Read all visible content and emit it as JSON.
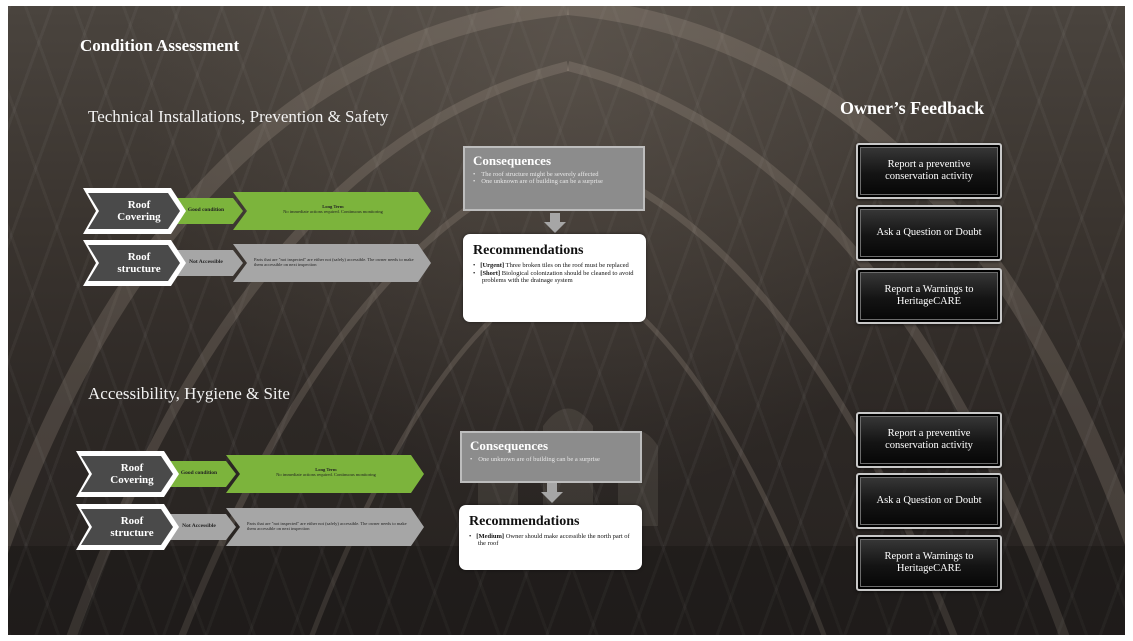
{
  "page": {
    "title": "Condition Assessment",
    "owner_feedback_title": "Owner’s Feedback"
  },
  "sections": [
    {
      "title": "Technical Installations, Prevention & Safety",
      "rows": [
        {
          "label_line1": "Roof",
          "label_line2": "Covering",
          "condition": "Good condition",
          "term_title": "Long Term",
          "term_text": "No immediate actions required. Continuous monitoring"
        },
        {
          "label_line1": "Roof",
          "label_line2": "structure",
          "condition": "Not Accessible",
          "term_title": "",
          "term_text": "Parts that are \"not inspected\" are either not (safely) accessible. The owner needs to make them accessible on next inspection"
        }
      ],
      "consequences": {
        "title": "Consequences",
        "items": [
          "The roof structure might be severely affected",
          "One unknown are of building can be a surprise"
        ]
      },
      "recommendations": {
        "title": "Recommendations",
        "items": [
          {
            "tag": "[Urgent]",
            "text": " Three broken tiles on the roof must be replaced"
          },
          {
            "tag": "[Short]",
            "text": " Biological colonization should be cleaned to avoid problems with the drainage system"
          }
        ]
      }
    },
    {
      "title": "Accessibility, Hygiene & Site",
      "rows": [
        {
          "label_line1": "Roof",
          "label_line2": "Covering",
          "condition": "Good condition",
          "term_title": "Long Term",
          "term_text": "No immediate actions required. Continuous monitoring"
        },
        {
          "label_line1": "Roof",
          "label_line2": "structure",
          "condition": "Not Accessible",
          "term_title": "",
          "term_text": "Parts that are \"not inspected\" are either not (safely) accessible. The owner needs to make them accessible on next inspection"
        }
      ],
      "consequences": {
        "title": "Consequences",
        "items": [
          "One unknown are of building can be a surprise"
        ]
      },
      "recommendations": {
        "title": "Recommendations",
        "items": [
          {
            "tag": "[Medium]",
            "text": " Owner should make accessible the north part of the roof"
          }
        ]
      }
    }
  ],
  "feedback_buttons": [
    [
      "Report a preventive conservation activity",
      "Ask a Question or Doubt",
      "Report a Warnings to HeritageCARE"
    ],
    [
      "Report a preventive conservation activity",
      "Ask a Question or Doubt",
      "Report a Warnings to HeritageCARE"
    ]
  ],
  "colors": {
    "good": "#7cb43c",
    "not_accessible": "#a6a6a6",
    "label_chevron": "#4a4a4a"
  }
}
